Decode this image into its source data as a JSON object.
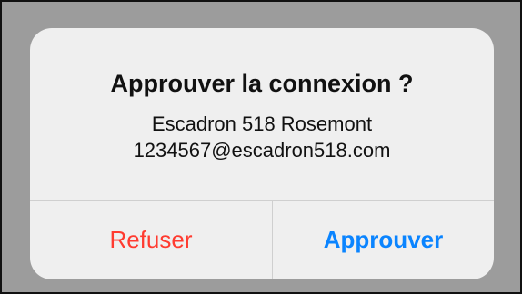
{
  "dialog": {
    "title": "Approuver la connexion ?",
    "organization": "Escadron 518 Rosemont",
    "email": "1234567@escadron518.com",
    "actions": {
      "refuse_label": "Refuser",
      "approve_label": "Approuver"
    }
  },
  "colors": {
    "overlay": "#9c9c9c",
    "dialog_background": "#efefef",
    "text": "#111111",
    "destructive_action": "#ff3b30",
    "primary_action": "#0a84ff",
    "divider": "#cfcfcf"
  }
}
